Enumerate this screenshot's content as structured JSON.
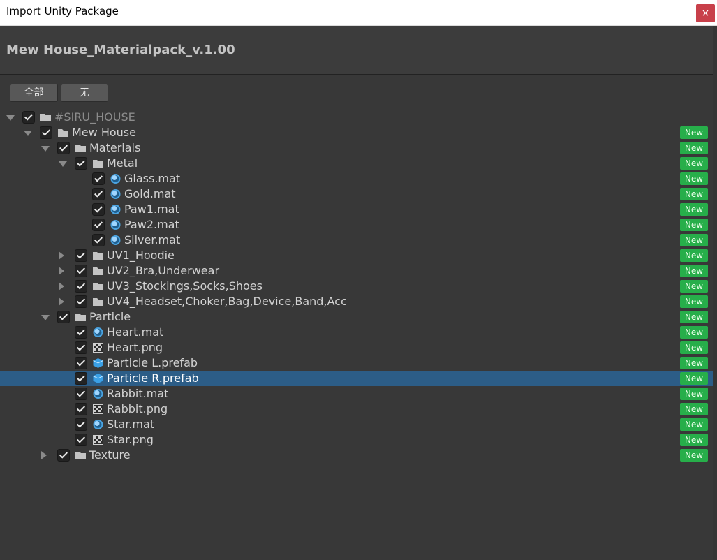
{
  "window": {
    "title": "Import Unity Package",
    "close_label": "×"
  },
  "package": {
    "name": "Mew House_Materialpack_v.1.00"
  },
  "buttons": {
    "all": "全部",
    "none": "无"
  },
  "badge_text": "New",
  "tree": [
    {
      "name": "#SIRU_HOUSE",
      "depth": 0,
      "icon": "folder-icon",
      "foldout": "open",
      "checked": true,
      "new": false,
      "selected": false
    },
    {
      "name": "Mew House",
      "depth": 1,
      "icon": "folder-icon",
      "foldout": "open",
      "checked": true,
      "new": true,
      "selected": false
    },
    {
      "name": "Materials",
      "depth": 2,
      "icon": "folder-icon",
      "foldout": "open",
      "checked": true,
      "new": true,
      "selected": false
    },
    {
      "name": "Metal",
      "depth": 3,
      "icon": "folder-icon",
      "foldout": "open",
      "checked": true,
      "new": true,
      "selected": false
    },
    {
      "name": "Glass.mat",
      "depth": 4,
      "icon": "material-icon",
      "foldout": "none",
      "checked": true,
      "new": true,
      "selected": false
    },
    {
      "name": "Gold.mat",
      "depth": 4,
      "icon": "material-icon",
      "foldout": "none",
      "checked": true,
      "new": true,
      "selected": false
    },
    {
      "name": "Paw1.mat",
      "depth": 4,
      "icon": "material-icon",
      "foldout": "none",
      "checked": true,
      "new": true,
      "selected": false
    },
    {
      "name": "Paw2.mat",
      "depth": 4,
      "icon": "material-icon",
      "foldout": "none",
      "checked": true,
      "new": true,
      "selected": false
    },
    {
      "name": "Silver.mat",
      "depth": 4,
      "icon": "material-icon",
      "foldout": "none",
      "checked": true,
      "new": true,
      "selected": false
    },
    {
      "name": "UV1_Hoodie",
      "depth": 3,
      "icon": "folder-icon",
      "foldout": "closed",
      "checked": true,
      "new": true,
      "selected": false
    },
    {
      "name": "UV2_Bra,Underwear",
      "depth": 3,
      "icon": "folder-icon",
      "foldout": "closed",
      "checked": true,
      "new": true,
      "selected": false
    },
    {
      "name": "UV3_Stockings,Socks,Shoes",
      "depth": 3,
      "icon": "folder-icon",
      "foldout": "closed",
      "checked": true,
      "new": true,
      "selected": false
    },
    {
      "name": "UV4_Headset,Choker,Bag,Device,Band,Acc",
      "depth": 3,
      "icon": "folder-icon",
      "foldout": "closed",
      "checked": true,
      "new": true,
      "selected": false
    },
    {
      "name": "Particle",
      "depth": 2,
      "icon": "folder-icon",
      "foldout": "open",
      "checked": true,
      "new": true,
      "selected": false
    },
    {
      "name": "Heart.mat",
      "depth": 3,
      "icon": "material-icon",
      "foldout": "none",
      "checked": true,
      "new": true,
      "selected": false
    },
    {
      "name": "Heart.png",
      "depth": 3,
      "icon": "texture-icon",
      "foldout": "none",
      "checked": true,
      "new": true,
      "selected": false
    },
    {
      "name": "Particle L.prefab",
      "depth": 3,
      "icon": "prefab-icon",
      "foldout": "none",
      "checked": true,
      "new": true,
      "selected": false
    },
    {
      "name": "Particle R.prefab",
      "depth": 3,
      "icon": "prefab-icon",
      "foldout": "none",
      "checked": true,
      "new": true,
      "selected": true
    },
    {
      "name": "Rabbit.mat",
      "depth": 3,
      "icon": "material-icon",
      "foldout": "none",
      "checked": true,
      "new": true,
      "selected": false
    },
    {
      "name": "Rabbit.png",
      "depth": 3,
      "icon": "texture-icon",
      "foldout": "none",
      "checked": true,
      "new": true,
      "selected": false
    },
    {
      "name": "Star.mat",
      "depth": 3,
      "icon": "material-icon",
      "foldout": "none",
      "checked": true,
      "new": true,
      "selected": false
    },
    {
      "name": "Star.png",
      "depth": 3,
      "icon": "texture-icon",
      "foldout": "none",
      "checked": true,
      "new": true,
      "selected": false
    },
    {
      "name": "Texture",
      "depth": 2,
      "icon": "folder-icon",
      "foldout": "closed",
      "checked": true,
      "new": true,
      "selected": false
    }
  ]
}
